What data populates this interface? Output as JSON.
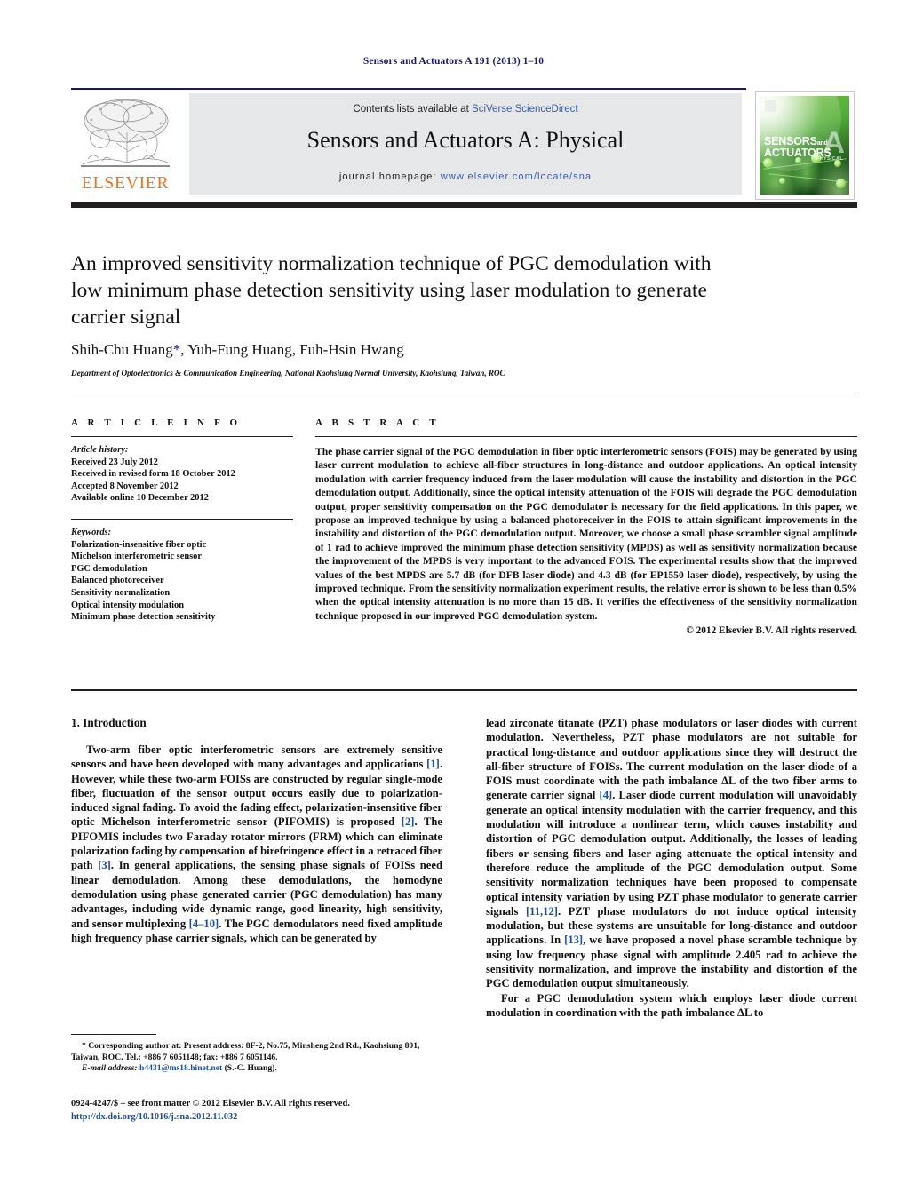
{
  "running_head": "Sensors and Actuators A 191 (2013) 1–10",
  "header": {
    "contents_prefix": "Contents lists available at ",
    "contents_link": "SciVerse ScienceDirect",
    "journal_title": "Sensors and Actuators A: Physical",
    "homepage_prefix": "journal homepage: ",
    "homepage_url": "www.elsevier.com/locate/sna",
    "publisher_logo_text": "ELSEVIER",
    "cover": {
      "line1": "SENSORS",
      "line1_small": "and",
      "line2": "ACTUATORS",
      "big_letter": "A",
      "subtitle": "PHYSICAL"
    }
  },
  "article": {
    "title": "An improved sensitivity normalization technique of PGC demodulation with low minimum phase detection sensitivity using laser modulation to generate carrier signal",
    "authors": "Shih-Chu Huang*, Yuh-Fung Huang, Fuh-Hsin Hwang",
    "author_star": "*",
    "affiliation": "Department of Optoelectronics & Communication Engineering, National Kaohsiung Normal University, Kaohsiung, Taiwan, ROC"
  },
  "article_info": {
    "heading": "A R T I C L E   I N F O",
    "history_label": "Article history:",
    "history": [
      "Received 23 July 2012",
      "Received in revised form 18 October 2012",
      "Accepted 8 November 2012",
      "Available online 10 December 2012"
    ],
    "keywords_label": "Keywords:",
    "keywords": [
      "Polarization-insensitive fiber optic",
      "Michelson interferometric sensor",
      "PGC demodulation",
      "Balanced photoreceiver",
      "Sensitivity normalization",
      "Optical intensity modulation",
      "Minimum phase detection sensitivity"
    ]
  },
  "abstract": {
    "heading": "A B S T R A C T",
    "text": "The phase carrier signal of the PGC demodulation in fiber optic interferometric sensors (FOIS) may be generated by using laser current modulation to achieve all-fiber structures in long-distance and outdoor applications. An optical intensity modulation with carrier frequency induced from the laser modulation will cause the instability and distortion in the PGC demodulation output. Additionally, since the optical intensity attenuation of the FOIS will degrade the PGC demodulation output, proper sensitivity compensation on the PGC demodulator is necessary for the field applications. In this paper, we propose an improved technique by using a balanced photoreceiver in the FOIS to attain significant improvements in the instability and distortion of the PGC demodulation output. Moreover, we choose a small phase scrambler signal amplitude of 1 rad to achieve improved the minimum phase detection sensitivity (MPDS) as well as sensitivity normalization because the improvement of the MPDS is very important to the advanced FOIS. The experimental results show that the improved values of the best MPDS are 5.7 dB (for DFB laser diode) and 4.3 dB (for EP1550 laser diode), respectively, by using the improved technique. From the sensitivity normalization experiment results, the relative error is shown to be less than 0.5% when the optical intensity attenuation is no more than 15 dB. It verifies the effectiveness of the sensitivity normalization technique proposed in our improved PGC demodulation system.",
    "copyright": "© 2012 Elsevier B.V. All rights reserved."
  },
  "body": {
    "section_heading": "1.  Introduction",
    "left_paragraphs": [
      "Two-arm fiber optic interferometric sensors are extremely sensitive sensors and have been developed with many advantages and applications [1]. However, while these two-arm FOISs are constructed by regular single-mode fiber, fluctuation of the sensor output occurs easily due to polarization-induced signal fading. To avoid the fading effect, polarization-insensitive fiber optic Michelson interferometric sensor (PIFOMIS) is proposed [2]. The PIFOMIS includes two Faraday rotator mirrors (FRM) which can eliminate polarization fading by compensation of birefringence effect in a retraced fiber path [3]. In general applications, the sensing phase signals of FOISs need linear demodulation. Among these demodulations, the homodyne demodulation using phase generated carrier (PGC demodulation) has many advantages, including wide dynamic range, good linearity, high sensitivity, and sensor multiplexing [4–10]. The PGC demodulators need fixed amplitude high frequency phase carrier signals, which can be generated by"
    ],
    "right_paragraphs": [
      "lead zirconate titanate (PZT) phase modulators or laser diodes with current modulation. Nevertheless, PZT phase modulators are not suitable for practical long-distance and outdoor applications since they will destruct the all-fiber structure of FOISs. The current modulation on the laser diode of a FOIS must coordinate with the path imbalance ΔL of the two fiber arms to generate carrier signal [4]. Laser diode current modulation will unavoidably generate an optical intensity modulation with the carrier frequency, and this modulation will introduce a nonlinear term, which causes instability and distortion of PGC demodulation output. Additionally, the losses of leading fibers or sensing fibers and laser aging attenuate the optical intensity and therefore reduce the amplitude of the PGC demodulation output. Some sensitivity normalization techniques have been proposed to compensate optical intensity variation by using PZT phase modulator to generate carrier signals [11,12]. PZT phase modulators do not induce optical intensity modulation, but these systems are unsuitable for long-distance and outdoor applications. In [13], we have proposed a novel phase scramble technique by using low frequency phase signal with amplitude 2.405 rad to achieve the sensitivity normalization, and improve the instability and distortion of the PGC demodulation output simultaneously.",
      "For a PGC demodulation system which employs laser diode current modulation in coordination with the path imbalance ΔL to"
    ]
  },
  "footer": {
    "corresponding_note": "* Corresponding author at: Present address: 8F-2, No.75, Minsheng 2nd Rd., Kaohsiung 801, Taiwan, ROC. Tel.: +886 7 6051148; fax: +886 7 6051146.",
    "email_label": "E-mail address:",
    "email": "h4431@ms18.hinet.net",
    "email_suffix": "(S.-C. Huang).",
    "issn_line": "0924-4247/$ – see front matter © 2012 Elsevier B.V. All rights reserved.",
    "doi": "http://dx.doi.org/10.1016/j.sna.2012.11.032"
  },
  "colors": {
    "link_blue": "#3b5ca8",
    "ref_blue": "#1a4f9c",
    "running_head_blue": "#1a1a6e",
    "elsevier_orange": "#E87722",
    "header_band_grey": "#e6e7e8",
    "rule_dark": "#231f20"
  }
}
